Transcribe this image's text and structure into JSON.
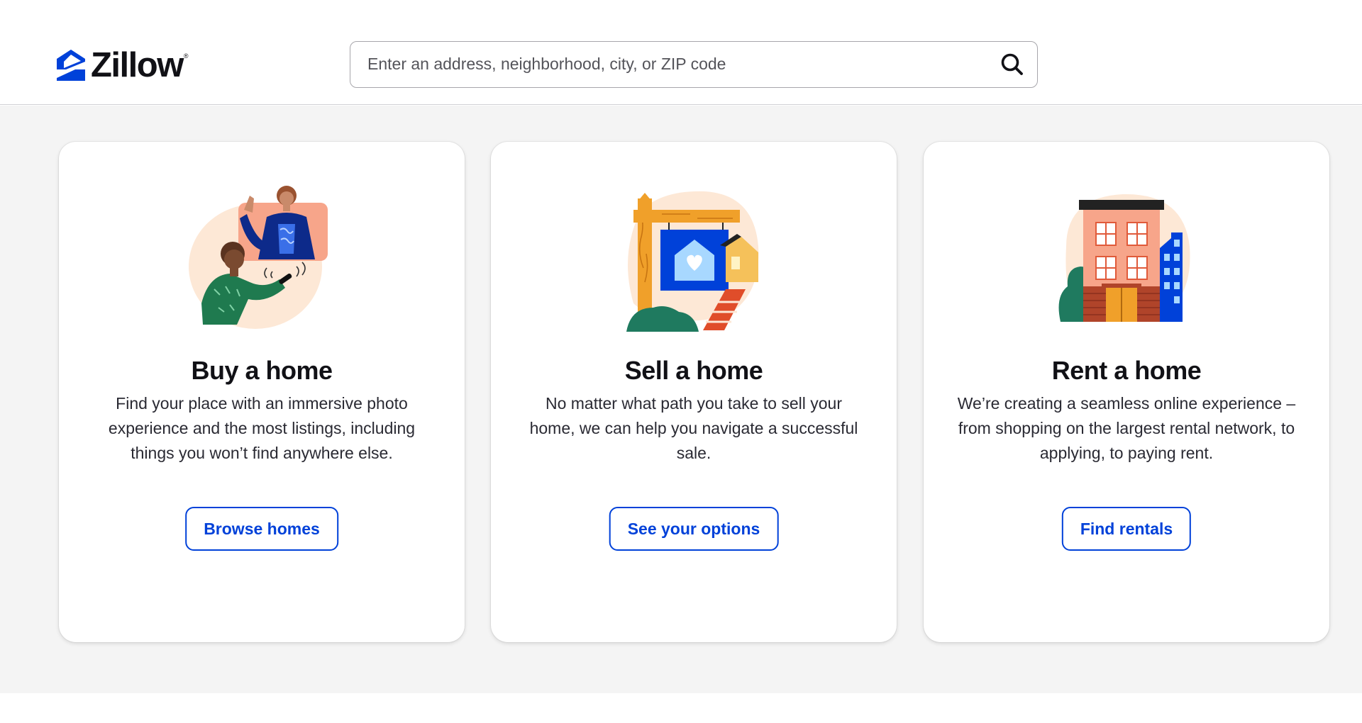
{
  "header": {
    "logo_text": "Zillow",
    "logo_reg": "®",
    "search": {
      "placeholder": "Enter an address, neighborhood, city, or ZIP code",
      "value": "",
      "icon": "search-icon"
    }
  },
  "cards": [
    {
      "illustration": "buy-home-illustration",
      "title": "Buy a home",
      "description": "Find your place with an immersive photo experience and the most listings, including things you won’t find anywhere else.",
      "button_label": "Browse homes"
    },
    {
      "illustration": "sell-home-illustration",
      "title": "Sell a home",
      "description": "No matter what path you take to sell your home, we can help you navigate a successful sale.",
      "button_label": "See your options"
    },
    {
      "illustration": "rent-home-illustration",
      "title": "Rent a home",
      "description": "We’re creating a seamless online experience – from shopping on the largest rental network, to applying, to paying rent.",
      "button_label": "Find rentals"
    }
  ],
  "colors": {
    "brand_blue": "#0041d9",
    "text": "#111116",
    "page_bg": "#f4f4f4"
  }
}
